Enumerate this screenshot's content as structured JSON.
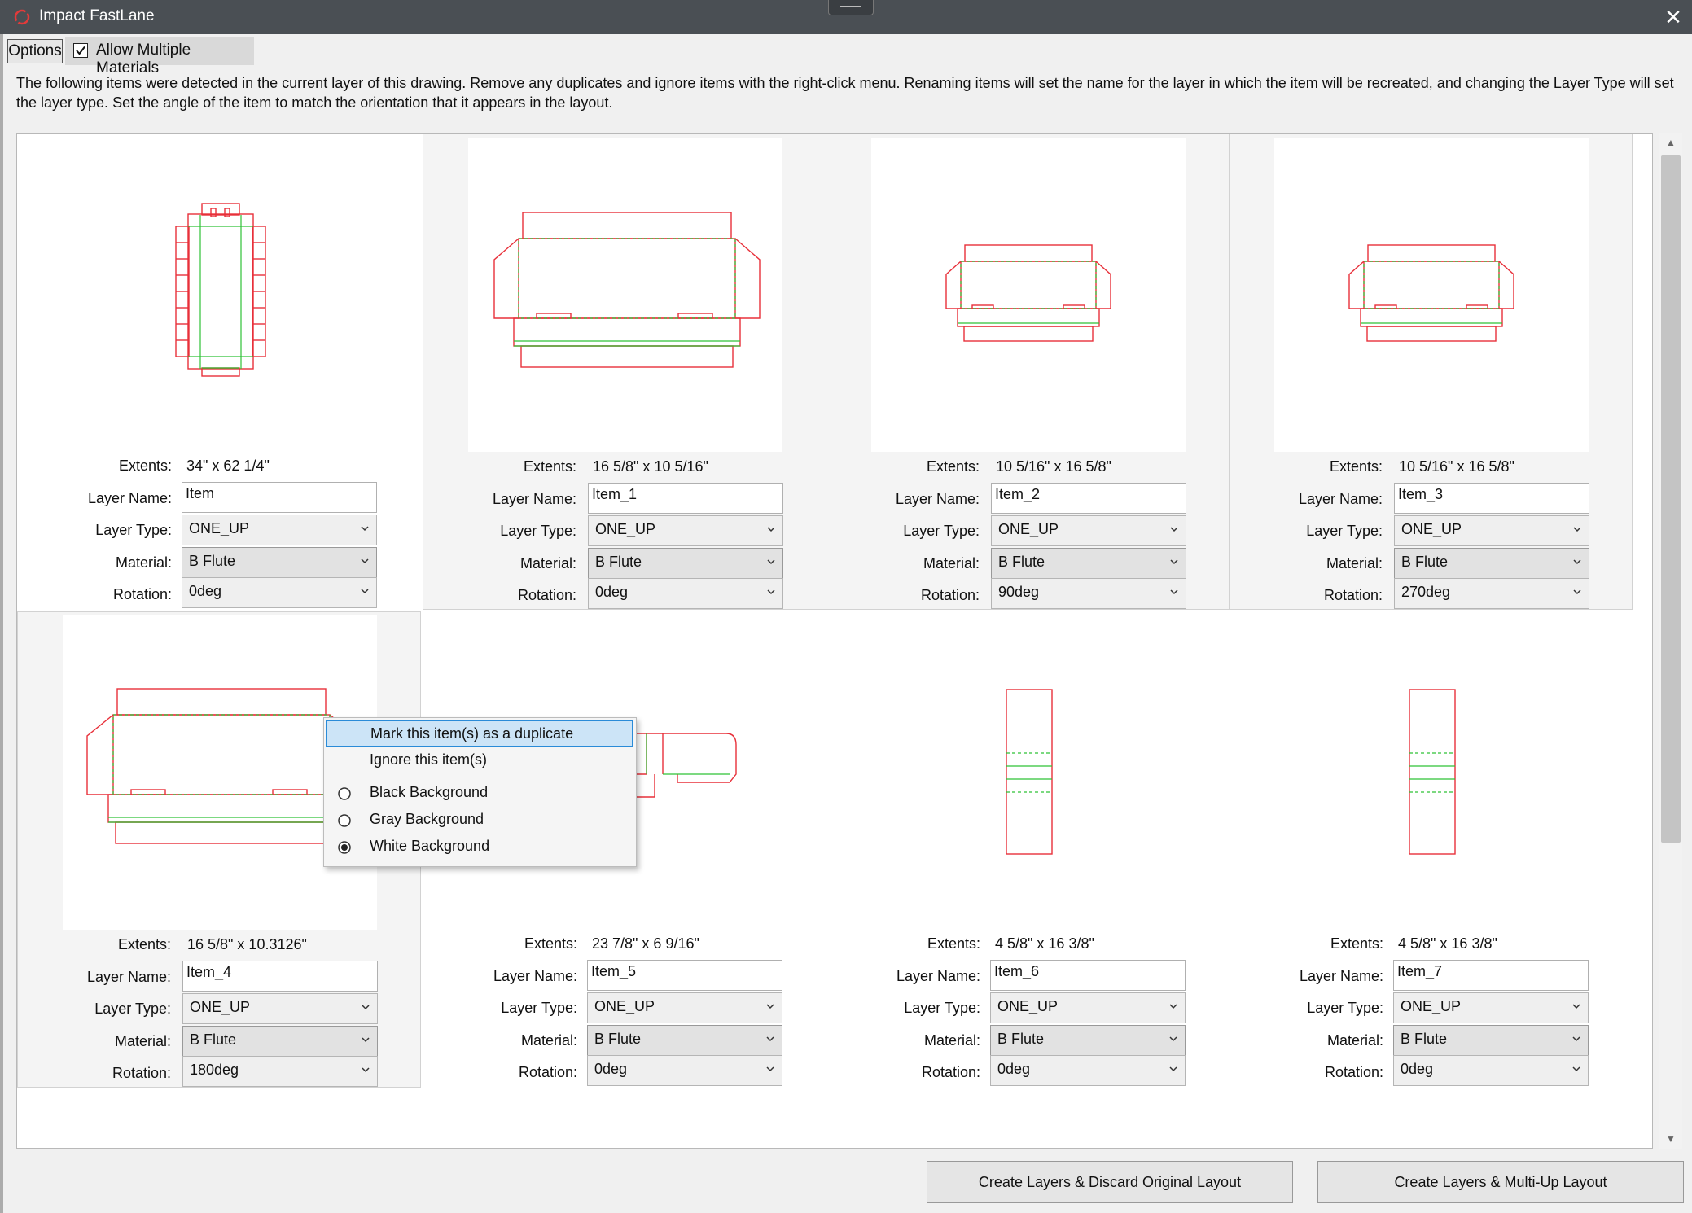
{
  "window": {
    "title": "Impact FastLane"
  },
  "toolbar": {
    "options_label": "Options",
    "allow_multiple_label": "Allow Multiple Materials",
    "allow_multiple_checked": true
  },
  "description": "The following items were detected in the current layer of this drawing. Remove any duplicates and ignore items with the right-click menu. Renaming items will set the name for the layer in which the item will be recreated, and changing the Layer Type will set the layer type. Set the angle of the item to match the orientation that it appears in the layout.",
  "labels": {
    "extents": "Extents:",
    "layer_name": "Layer Name:",
    "layer_type": "Layer Type:",
    "material": "Material:",
    "rotation": "Rotation:"
  },
  "items": [
    {
      "extents": "34\" x 62 1/4\"",
      "layer_name": "Item",
      "layer_type": "ONE_UP",
      "material": "B Flute",
      "rotation": "0deg"
    },
    {
      "extents": "16 5/8\" x 10 5/16\"",
      "layer_name": "Item_1",
      "layer_type": "ONE_UP",
      "material": "B Flute",
      "rotation": "0deg"
    },
    {
      "extents": "10 5/16\" x 16 5/8\"",
      "layer_name": "Item_2",
      "layer_type": "ONE_UP",
      "material": "B Flute",
      "rotation": "90deg"
    },
    {
      "extents": "10 5/16\" x 16 5/8\"",
      "layer_name": "Item_3",
      "layer_type": "ONE_UP",
      "material": "B Flute",
      "rotation": "270deg"
    },
    {
      "extents": "16 5/8\" x 10.3126\"",
      "layer_name": "Item_4",
      "layer_type": "ONE_UP",
      "material": "B Flute",
      "rotation": "180deg"
    },
    {
      "extents": "23 7/8\" x 6 9/16\"",
      "layer_name": "Item_5",
      "layer_type": "ONE_UP",
      "material": "B Flute",
      "rotation": "0deg"
    },
    {
      "extents": "4 5/8\" x 16 3/8\"",
      "layer_name": "Item_6",
      "layer_type": "ONE_UP",
      "material": "B Flute",
      "rotation": "0deg"
    },
    {
      "extents": "4 5/8\" x 16 3/8\"",
      "layer_name": "Item_7",
      "layer_type": "ONE_UP",
      "material": "B Flute",
      "rotation": "0deg"
    }
  ],
  "context_menu": {
    "mark_duplicate": "Mark this item(s) as a duplicate",
    "ignore": "Ignore this item(s)",
    "black_bg": "Black Background",
    "gray_bg": "Gray Background",
    "white_bg": "White Background",
    "selected_background": "White Background"
  },
  "buttons": {
    "discard": "Create Layers & Discard Original Layout",
    "multiup": "Create Layers & Multi-Up Layout"
  },
  "colors": {
    "cut_line": "#e8303a",
    "crease_line": "#2ec236",
    "titlebar": "#4a4f54",
    "menu_highlight": "#cce4f7"
  }
}
